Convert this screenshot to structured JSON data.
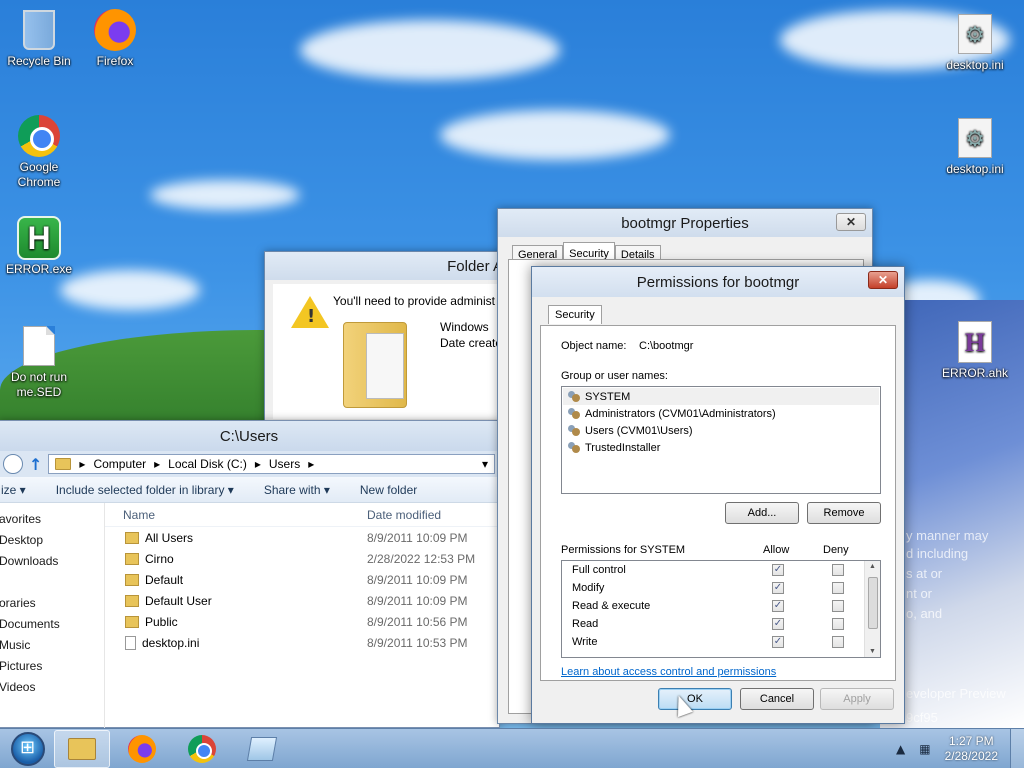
{
  "desktop": {
    "icons": [
      {
        "label": "Recycle Bin"
      },
      {
        "label": "Firefox"
      },
      {
        "label": "Google Chrome"
      },
      {
        "label": "ERROR.exe"
      },
      {
        "label": "Do not run me.SED"
      },
      {
        "label": "desktop.ini"
      },
      {
        "label": "desktop.ini"
      },
      {
        "label": "ERROR.ahk"
      }
    ],
    "wallpaper_text": [
      "y manner may",
      "d including",
      "s at or",
      "nt or",
      "o, and",
      "eveloper Preview",
      "9cf95"
    ]
  },
  "explorer": {
    "title": "C:\\Users",
    "breadcrumb": [
      "Computer",
      "Local Disk (C:)",
      "Users"
    ],
    "toolbar": [
      "ize",
      "Include selected folder in library",
      "Share with",
      "New folder"
    ],
    "nav": [
      "avorites",
      "Desktop",
      "Downloads",
      "",
      "oraries",
      "Documents",
      "Music",
      "Pictures",
      "Videos"
    ],
    "columns": {
      "name": "Name",
      "date": "Date modified"
    },
    "rows": [
      {
        "name": "All Users",
        "date": "8/9/2011 10:09 PM",
        "kind": "shortcut"
      },
      {
        "name": "Cirno",
        "date": "2/28/2022 12:53 PM",
        "kind": "folder"
      },
      {
        "name": "Default",
        "date": "8/9/2011 10:09 PM",
        "kind": "folder"
      },
      {
        "name": "Default User",
        "date": "8/9/2011 10:09 PM",
        "kind": "shortcut"
      },
      {
        "name": "Public",
        "date": "8/9/2011 10:56 PM",
        "kind": "folder"
      },
      {
        "name": "desktop.ini",
        "date": "8/9/2011 10:53 PM",
        "kind": "file"
      }
    ]
  },
  "folder_access": {
    "title": "Folder A",
    "message": "You'll need to provide administ",
    "line1": "Windows",
    "line2": "Date create"
  },
  "properties": {
    "title": "bootmgr Properties",
    "tabs": [
      "General",
      "Security",
      "Details"
    ],
    "close": "✕"
  },
  "permissions": {
    "title": "Permissions for bootmgr",
    "close": "✕",
    "tab": "Security",
    "object_label": "Object name:",
    "object_value": "C:\\bootmgr",
    "group_label": "Group or user names:",
    "groups": [
      "SYSTEM",
      "Administrators (CVM01\\Administrators)",
      "Users (CVM01\\Users)",
      "TrustedInstaller"
    ],
    "add": "Add...",
    "remove": "Remove",
    "perm_header": "Permissions for SYSTEM",
    "allow": "Allow",
    "deny": "Deny",
    "perms": [
      {
        "name": "Full control",
        "allow": true,
        "deny": false
      },
      {
        "name": "Modify",
        "allow": true,
        "deny": false
      },
      {
        "name": "Read & execute",
        "allow": true,
        "deny": false
      },
      {
        "name": "Read",
        "allow": true,
        "deny": false
      },
      {
        "name": "Write",
        "allow": true,
        "deny": false
      }
    ],
    "link": "Learn about access control and permissions",
    "ok": "OK",
    "cancel": "Cancel",
    "apply": "Apply"
  },
  "taskbar": {
    "time": "1:27 PM",
    "date": "2/28/2022",
    "tray_icons": [
      "flag-icon",
      "network-icon",
      "speaker-icon"
    ]
  }
}
